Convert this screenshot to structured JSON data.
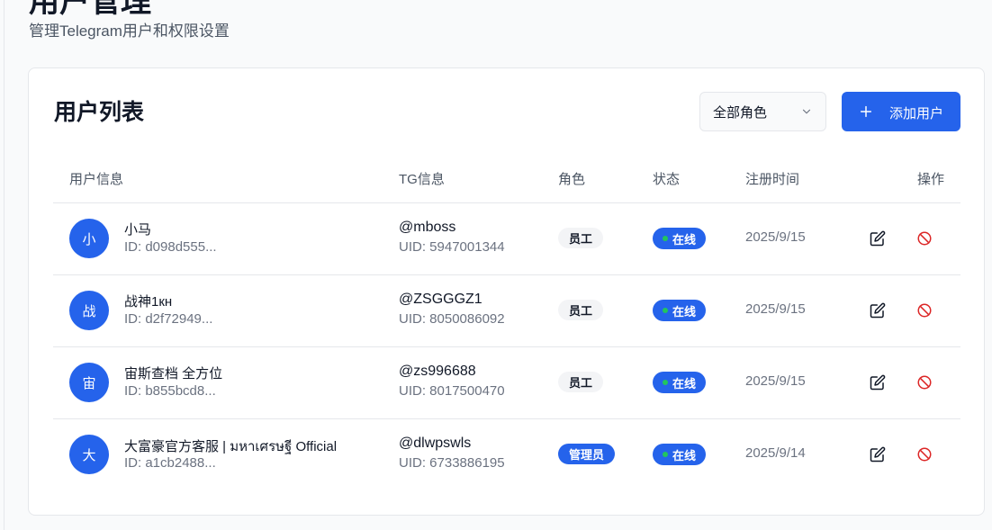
{
  "header": {
    "title": "用户管理",
    "subtitle": "管理Telegram用户和权限设置"
  },
  "card": {
    "title": "用户列表",
    "role_filter": {
      "selected": "全部角色",
      "icon": "chevron-down-icon"
    },
    "add_button": {
      "label": "添加用户",
      "icon": "plus-icon"
    }
  },
  "table": {
    "headers": {
      "user_info": "用户信息",
      "tg_info": "TG信息",
      "role": "角色",
      "status": "状态",
      "registered": "注册时间",
      "actions": "操作"
    },
    "rows": [
      {
        "avatar": "小",
        "name": "小马",
        "id": "ID: d098d555...",
        "tg": "@mboss",
        "tg_uid": "UID: 5947001344",
        "role": "员工",
        "role_type": "staff",
        "status": "在线",
        "date": "2025/9/15"
      },
      {
        "avatar": "战",
        "name": "战神1кн",
        "id": "ID: d2f72949...",
        "tg": "@ZSGGGZ1",
        "tg_uid": "UID: 8050086092",
        "role": "员工",
        "role_type": "staff",
        "status": "在线",
        "date": "2025/9/15"
      },
      {
        "avatar": "宙",
        "name": "宙斯查档 全方位",
        "id": "ID: b855bcd8...",
        "tg": "@zs996688",
        "tg_uid": "UID: 8017500470",
        "role": "员工",
        "role_type": "staff",
        "status": "在线",
        "date": "2025/9/15"
      },
      {
        "avatar": "大",
        "name": "大富豪官方客服 | มหาเศรษฐี Official",
        "id": "ID: a1cb2488...",
        "tg": "@dlwpswls",
        "tg_uid": "UID: 6733886195",
        "role": "管理员",
        "role_type": "admin",
        "status": "在线",
        "date": "2025/9/14"
      }
    ]
  },
  "colors": {
    "accent": "#2563eb",
    "online_dot": "#22c55e",
    "danger": "#dc2626"
  }
}
